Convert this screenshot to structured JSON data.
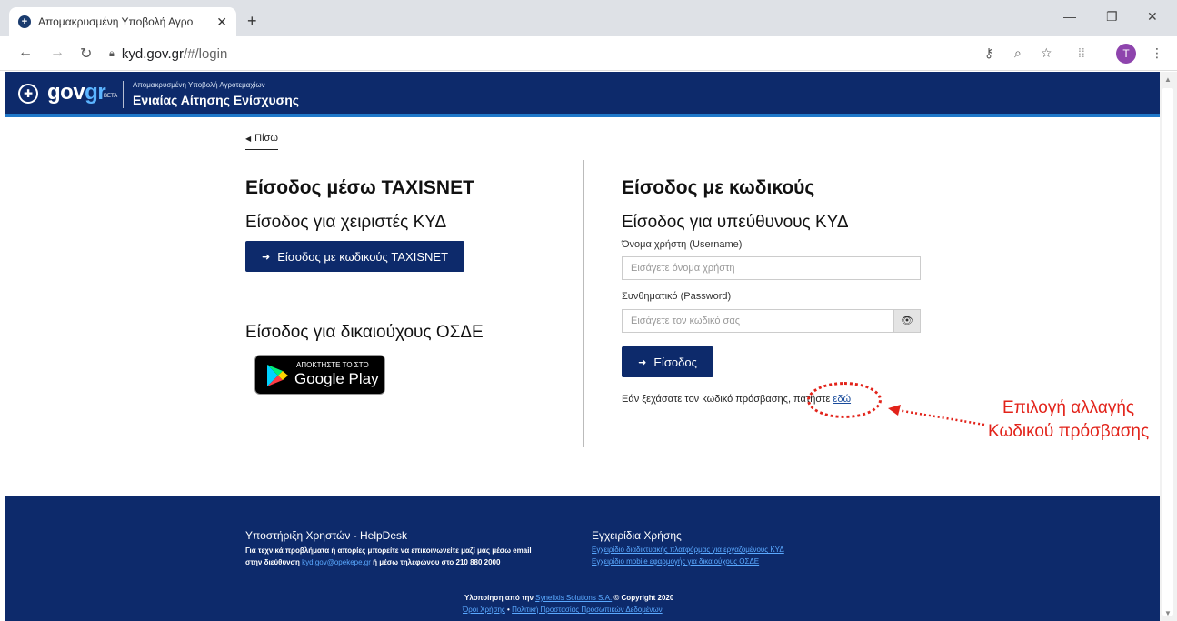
{
  "browser": {
    "tab_title": "Απομακρυσμένη Υποβολή Αγρο",
    "tab_close": "✕",
    "new_tab": "+",
    "url_domain": "kyd.gov.gr",
    "url_path": "/#/login",
    "profile_initial": "T"
  },
  "header": {
    "logo_gov": "gov",
    "logo_gr": "gr",
    "logo_beta": "BETA",
    "subtitle": "Απομακρυσμένη Υποβολή Αγροτεμαχίων",
    "title": "Ενιαίας Αίτησης Ενίσχυσης"
  },
  "back": {
    "label": "Πίσω"
  },
  "left": {
    "heading": "Είσοδος μέσω TAXISNET",
    "sub_operators": "Είσοδος για χειριστές ΚΥΔ",
    "taxisnet_button": "Είσοδος με κωδικούς TAXISNET",
    "sub_beneficiaries": "Είσοδος για δικαιούχους ΟΣΔΕ",
    "gplay_small": "ΑΠΟΚΤΗΣΤΕ ΤΟ ΣΤΟ",
    "gplay_big": "Google Play"
  },
  "right": {
    "heading": "Είσοδος με κωδικούς",
    "sub_heading": "Είσοδος για υπεύθυνους ΚΥΔ",
    "username_label": "Όνομα χρήστη (Username)",
    "username_placeholder": "Εισάγετε όνομα χρήστη",
    "password_label": "Συνθηματικό (Password)",
    "password_placeholder": "Εισάγετε τον κωδικό σας",
    "login_button": "Είσοδος",
    "forgot_text": "Εάν ξεχάσατε τον κωδικό πρόσβασης, πατήστε",
    "forgot_link": "εδώ"
  },
  "annotation": {
    "line1": "Επιλογή αλλαγής",
    "line2": "Κωδικού πρόσβασης",
    "color": "#e2231a"
  },
  "footer": {
    "helpdesk_title": "Υποστήριξη Χρηστών - HelpDesk",
    "helpdesk_text1": "Για τεχνικά προβλήματα ή απορίες μπορείτε να επικοινωνείτε μαζί μας μέσω email",
    "helpdesk_text2a": "στην διεύθυνση",
    "helpdesk_email": "kyd.gov@opekepe.gr",
    "helpdesk_text2b": "ή μέσω τηλεφώνου στο 210 880 2000",
    "manuals_title": "Εγχειρίδια Χρήσης",
    "manual1": "Εγχειρίδιο διαδικτυακής πλατφόρμας για εργαζομένους ΚΥΔ",
    "manual2": "Εγχειρίδιο mobile εφαρμογής για δικαιούχους ΟΣΔΕ",
    "impl_text": "Υλοποίηση από την",
    "impl_link": "Synelixis Solutions S.A.",
    "copyright": "© Copyright 2020",
    "terms": "Όροι Χρήσης",
    "privacy": "Πολιτική Προστασίας Προσωπικών Δεδομένων",
    "bullet": "•"
  },
  "colors": {
    "brand_navy": "#0d2a6b",
    "accent_blue": "#1f78c9",
    "link": "#5aa9ff"
  }
}
